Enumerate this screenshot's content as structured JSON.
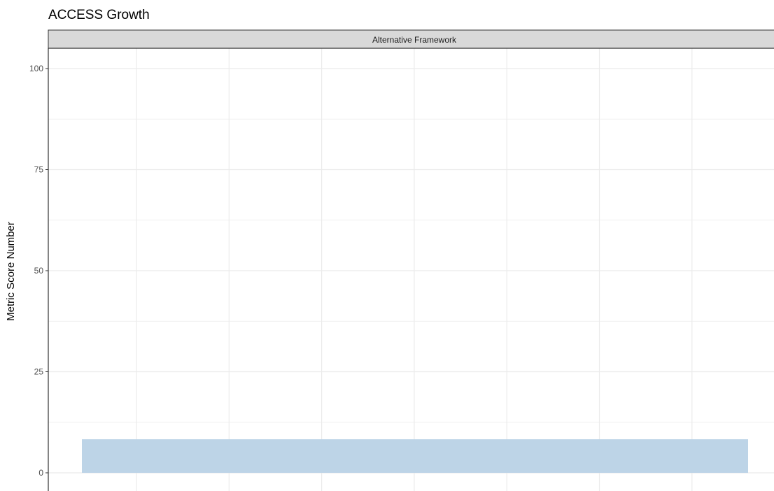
{
  "chart_data": {
    "type": "bar",
    "title": "ACCESS Growth",
    "facet_label": "Alternative Framework",
    "xlabel": "",
    "ylabel": "Metric Score Number",
    "ylim": [
      0,
      105
    ],
    "y_ticks": [
      0,
      25,
      50,
      75,
      100
    ],
    "x_gridlines": 7,
    "grid": true,
    "series": [
      {
        "values": [
          8.3
        ]
      }
    ],
    "bar_color": "#bdd4e7",
    "panel_border_color": "#333333",
    "strip_fill_color": "#d9d9d9",
    "gridline_color": "#ebebeb"
  }
}
